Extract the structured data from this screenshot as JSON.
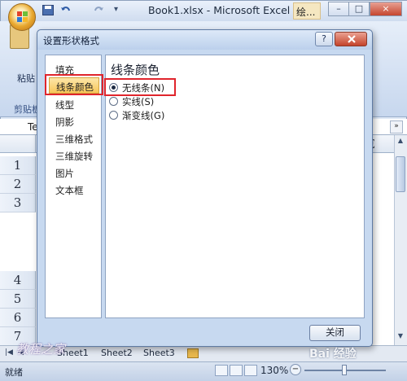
{
  "window": {
    "title": "Book1.xlsx - Microsoft Excel",
    "context_tab": "绘...",
    "minimize": "–",
    "restore": "□",
    "close": "×"
  },
  "ribbon": {
    "paste_label": "粘贴",
    "clipboard_label": "剪贴板"
  },
  "formula_bar": {
    "namebox": "Te",
    "expand": "»"
  },
  "grid": {
    "column_visible": "E",
    "rows": [
      "1",
      "2",
      "3",
      "4",
      "5",
      "6",
      "7"
    ]
  },
  "sheet_tabs": {
    "tabs": [
      "Sheet1",
      "Sheet2",
      "Sheet3"
    ]
  },
  "statusbar": {
    "status": "就绪",
    "zoom": "130%",
    "zoom_minus": "−"
  },
  "dialog": {
    "title": "设置形状格式",
    "help": "?",
    "nav": [
      {
        "label": "填充"
      },
      {
        "label": "线条颜色"
      },
      {
        "label": "线型"
      },
      {
        "label": "阴影"
      },
      {
        "label": "三维格式"
      },
      {
        "label": "三维旋转"
      },
      {
        "label": "图片"
      },
      {
        "label": "文本框"
      }
    ],
    "section_title": "线条颜色",
    "options": [
      {
        "label": "无线条(N)",
        "checked": true
      },
      {
        "label": "实线(S)",
        "checked": false
      },
      {
        "label": "渐变线(G)",
        "checked": false
      }
    ],
    "close_button": "关闭"
  },
  "watermarks": {
    "left": "教程之家",
    "right": "Bai 经验"
  },
  "colors": {
    "highlight": "#e0252c",
    "selected_nav": "#f7c65a"
  }
}
